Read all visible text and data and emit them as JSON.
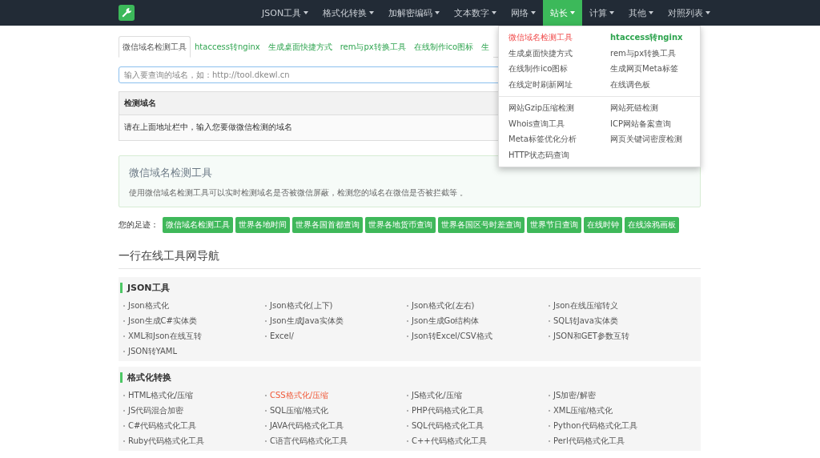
{
  "navbar": {
    "items": [
      {
        "label": "JSON工具",
        "selected": false
      },
      {
        "label": "格式化转换",
        "selected": false
      },
      {
        "label": "加解密编码",
        "selected": false
      },
      {
        "label": "文本数字",
        "selected": false
      },
      {
        "label": "网络",
        "selected": false
      },
      {
        "label": "站长",
        "selected": true
      },
      {
        "label": "计算",
        "selected": false
      },
      {
        "label": "其他",
        "selected": false
      },
      {
        "label": "对照列表",
        "selected": false
      }
    ]
  },
  "tabs": [
    {
      "label": "微信域名检测工具",
      "selected": true
    },
    {
      "label": "htaccess转nginx",
      "selected": false
    },
    {
      "label": "生成桌面快捷方式",
      "selected": false
    },
    {
      "label": "rem与px转换工具",
      "selected": false
    },
    {
      "label": "在线制作ico图标",
      "selected": false
    },
    {
      "label": "生",
      "selected": false
    }
  ],
  "search": {
    "placeholder": "输入要查询的域名，如：http://tool.dkewl.cn"
  },
  "table": {
    "columns": [
      "检测域名"
    ],
    "rows": [
      [
        "请在上面地址栏中，输入您要做微信检测的域名"
      ]
    ]
  },
  "dropdown": {
    "groups": [
      {
        "items": [
          {
            "label": "微信域名检测工具",
            "selected": true,
            "hot": false
          },
          {
            "label": "htaccess转nginx",
            "selected": false,
            "hot": true
          },
          {
            "label": "生成桌面快捷方式",
            "selected": false,
            "hot": false
          },
          {
            "label": "rem与px转换工具",
            "selected": false,
            "hot": false
          },
          {
            "label": "在线制作ico图标",
            "selected": false,
            "hot": false
          },
          {
            "label": "生成网页Meta标签",
            "selected": false,
            "hot": false
          },
          {
            "label": "在线定时刷新网址",
            "selected": false,
            "hot": false
          },
          {
            "label": "在线调色板",
            "selected": false,
            "hot": false
          }
        ]
      },
      {
        "items": [
          {
            "label": "网站Gzip压缩检测",
            "selected": false,
            "hot": false
          },
          {
            "label": "网站死链检测",
            "selected": false,
            "hot": false
          },
          {
            "label": "Whois查询工具",
            "selected": false,
            "hot": false
          },
          {
            "label": "ICP网站备案查询",
            "selected": false,
            "hot": false
          },
          {
            "label": "Meta标签优化分析",
            "selected": false,
            "hot": false
          },
          {
            "label": "网页关键词密度检测",
            "selected": false,
            "hot": false
          },
          {
            "label": "HTTP状态码查询",
            "selected": false,
            "hot": false
          }
        ]
      }
    ]
  },
  "info": {
    "title": "微信域名检测工具",
    "text": "使用微信域名检测工具可以实时检测域名是否被微信屏蔽，检测您的域名在微信是否被拦截等 。"
  },
  "footprints": {
    "label": "您的足迹：",
    "tags": [
      "微信域名检测工具",
      "世界各地时间",
      "世界各国首都查询",
      "世界各地货币查询",
      "世界各国区号时差查询",
      "世界节日查询",
      "在线时钟",
      "在线涂鸦画板"
    ]
  },
  "nav_title": "一行在线工具网导航",
  "sections": [
    {
      "title": "JSON工具",
      "links": [
        {
          "label": "Json格式化",
          "selected": false
        },
        {
          "label": "Json格式化(上下)",
          "selected": false
        },
        {
          "label": "Json格式化(左右)",
          "selected": false
        },
        {
          "label": "Json在线压缩转义",
          "selected": false
        },
        {
          "label": "Json生成C#实体类",
          "selected": false
        },
        {
          "label": "Json生成Java实体类",
          "selected": false
        },
        {
          "label": "Json生成Go结构体",
          "selected": false
        },
        {
          "label": "SQL转Java实体类",
          "selected": false
        },
        {
          "label": "XML和Json在线互转",
          "selected": false
        },
        {
          "label": "Excel/",
          "selected": false
        },
        {
          "label": "Json转Excel/CSV格式",
          "selected": false
        },
        {
          "label": "JSON和GET参数互转",
          "selected": false
        },
        {
          "label": "JSON转YAML",
          "selected": false
        }
      ]
    },
    {
      "title": "格式化转换",
      "links": [
        {
          "label": "HTML格式化/压缩",
          "selected": false
        },
        {
          "label": "CSS格式化/压缩",
          "selected": true
        },
        {
          "label": "JS格式化/压缩",
          "selected": false
        },
        {
          "label": "JS加密/解密",
          "selected": false
        },
        {
          "label": "JS代码混合加密",
          "selected": false
        },
        {
          "label": "SQL压缩/格式化",
          "selected": false
        },
        {
          "label": "PHP代码格式化工具",
          "selected": false
        },
        {
          "label": "XML压缩/格式化",
          "selected": false
        },
        {
          "label": "C#代码格式化工具",
          "selected": false
        },
        {
          "label": "JAVA代码格式化工具",
          "selected": false
        },
        {
          "label": "SQL代码格式化工具",
          "selected": false
        },
        {
          "label": "Python代码格式化工具",
          "selected": false
        },
        {
          "label": "Ruby代码格式化工具",
          "selected": false
        },
        {
          "label": "C语言代码格式化工具",
          "selected": false
        },
        {
          "label": "C++代码格式化工具",
          "selected": false
        },
        {
          "label": "Perl代码格式化工具",
          "selected": false
        }
      ]
    }
  ]
}
